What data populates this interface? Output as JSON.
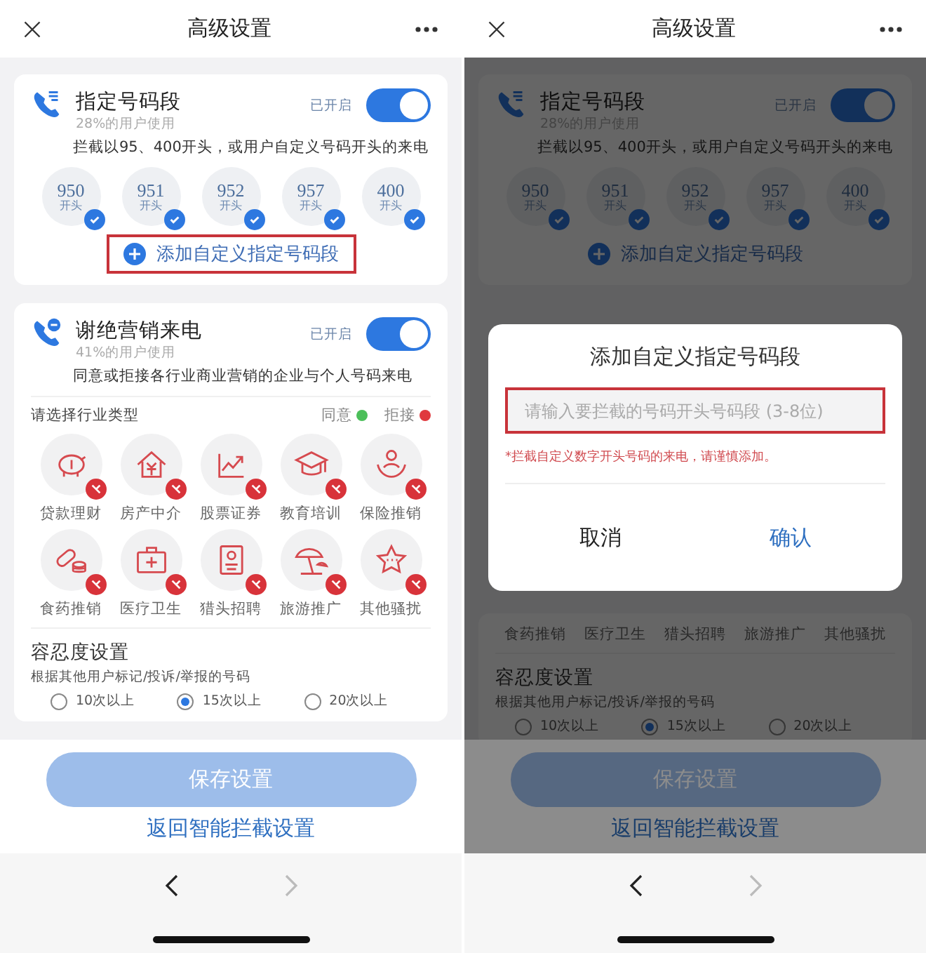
{
  "screens": [
    {
      "title": "高级设置",
      "dimmed": false,
      "number_card": {
        "title": "指定号码段",
        "usage": "28%的用户使用",
        "status": "已开启",
        "on": true,
        "description": "拦截以95、400开头，或用户自定义号码开头的来电",
        "prefixes": [
          {
            "number": "950",
            "label": "开头",
            "checked": true
          },
          {
            "number": "951",
            "label": "开头",
            "checked": true
          },
          {
            "number": "952",
            "label": "开头",
            "checked": true
          },
          {
            "number": "957",
            "label": "开头",
            "checked": true
          },
          {
            "number": "400",
            "label": "开头",
            "checked": true
          }
        ],
        "add_button": {
          "label": "添加自定义指定号码段",
          "highlighted": true
        }
      },
      "marketing_card": {
        "title": "谢绝营销来电",
        "usage": "41%的用户使用",
        "status": "已开启",
        "on": true,
        "description": "同意或拒接各行业商业营销的企业与个人号码来电",
        "prompt": "请选择行业类型",
        "legend": [
          {
            "label": "同意",
            "color": "#4cbf5a"
          },
          {
            "label": "拒接",
            "color": "#e0393e"
          }
        ],
        "industries": [
          {
            "label": "贷款理财",
            "rejected": true
          },
          {
            "label": "房产中介",
            "rejected": true
          },
          {
            "label": "股票证券",
            "rejected": true
          },
          {
            "label": "教育培训",
            "rejected": true
          },
          {
            "label": "保险推销",
            "rejected": true
          },
          {
            "label": "食药推销",
            "rejected": true
          },
          {
            "label": "医疗卫生",
            "rejected": true
          },
          {
            "label": "猎头招聘",
            "rejected": true
          },
          {
            "label": "旅游推广",
            "rejected": true
          },
          {
            "label": "其他骚扰",
            "rejected": true
          }
        ]
      },
      "tolerance": {
        "title": "容忍度设置",
        "description": "根据其他用户标记/投诉/举报的号码",
        "options": [
          {
            "label": "10次以上",
            "selected": false
          },
          {
            "label": "15次以上",
            "selected": true
          },
          {
            "label": "20次以上",
            "selected": false
          }
        ]
      },
      "save_button": {
        "label": "保存设置",
        "disabled": true
      },
      "back_link": "返回智能拦截设置",
      "nav": {
        "forward_disabled": true
      }
    },
    {
      "title": "高级设置",
      "dimmed": true,
      "number_card": {
        "title": "指定号码段",
        "usage": "28%的用户使用",
        "status": "已开启",
        "on": true,
        "description": "拦截以95、400开头，或用户自定义号码开头的来电",
        "prefixes": [
          {
            "number": "950",
            "label": "开头",
            "checked": true
          },
          {
            "number": "951",
            "label": "开头",
            "checked": true
          },
          {
            "number": "952",
            "label": "开头",
            "checked": true
          },
          {
            "number": "957",
            "label": "开头",
            "checked": true
          },
          {
            "number": "400",
            "label": "开头",
            "checked": true
          }
        ],
        "add_button": {
          "label": "添加自定义指定号码段",
          "highlighted": false
        }
      },
      "dialog": {
        "title": "添加自定义指定号码段",
        "placeholder": "请输入要拦截的号码开头号码段 (3-8位)",
        "highlighted": true,
        "note": "*拦截自定义数字开头号码的来电，请谨慎添加。",
        "buttons": [
          {
            "label": "取消",
            "kind": "cancel"
          },
          {
            "label": "确认",
            "kind": "confirm"
          }
        ]
      },
      "marketing_card": {
        "industries": [
          {
            "label": "食药推销"
          },
          {
            "label": "医疗卫生"
          },
          {
            "label": "猎头招聘"
          },
          {
            "label": "旅游推广"
          },
          {
            "label": "其他骚扰"
          }
        ]
      },
      "tolerance": {
        "title": "容忍度设置",
        "description": "根据其他用户标记/投诉/举报的号码",
        "options": [
          {
            "label": "10次以上",
            "selected": false
          },
          {
            "label": "15次以上",
            "selected": true
          },
          {
            "label": "20次以上",
            "selected": false
          }
        ]
      },
      "save_button": {
        "label": "保存设置",
        "disabled": true
      },
      "back_link": "返回智能拦截设置",
      "nav": {
        "forward_disabled": true
      }
    }
  ]
}
